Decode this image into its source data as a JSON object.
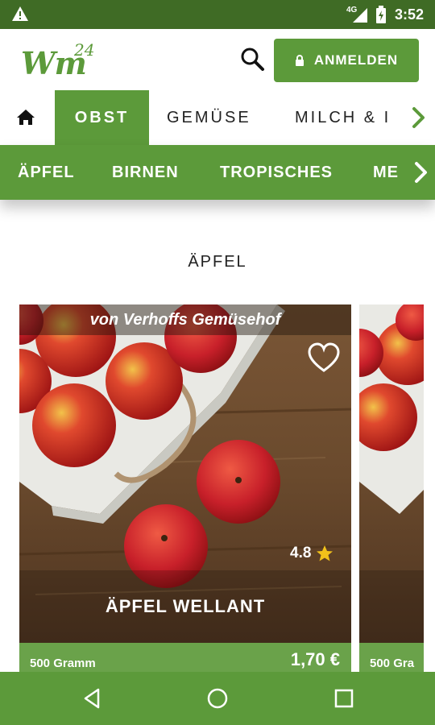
{
  "status_bar": {
    "network": "4G",
    "time": "3:52",
    "icons": [
      "warning-icon",
      "signal-icon",
      "battery-icon"
    ]
  },
  "header": {
    "logo_text": "Wm",
    "logo_sup": "24",
    "login_label": "ANMELDEN",
    "icons": [
      "search-icon",
      "lock-icon"
    ]
  },
  "category_tabs": {
    "items": [
      "OBST",
      "GEMÜSE",
      "MILCH & I"
    ],
    "active": "OBST",
    "icons": [
      "home-icon",
      "chevron-right-icon"
    ]
  },
  "sub_tabs": {
    "items": [
      "ÄPFEL",
      "BIRNEN",
      "TROPISCHES",
      "ME"
    ],
    "icons": [
      "chevron-right-icon"
    ]
  },
  "section_title": "ÄPFEL",
  "products": [
    {
      "origin": "von Verhoffs Gemüsehof",
      "name": "ÄPFEL WELLANT",
      "rating": "4.8",
      "weight": "500 Gramm",
      "price": "1,70 €"
    },
    {
      "weight": "500 Gra"
    }
  ],
  "colors": {
    "status_bar": "#3f6b25",
    "brand_green": "#5c9a3a",
    "card_footer": "#6aa24a",
    "star": "#f2c21a"
  },
  "nav_icons": [
    "back-icon",
    "home-circle-icon",
    "recents-icon"
  ]
}
